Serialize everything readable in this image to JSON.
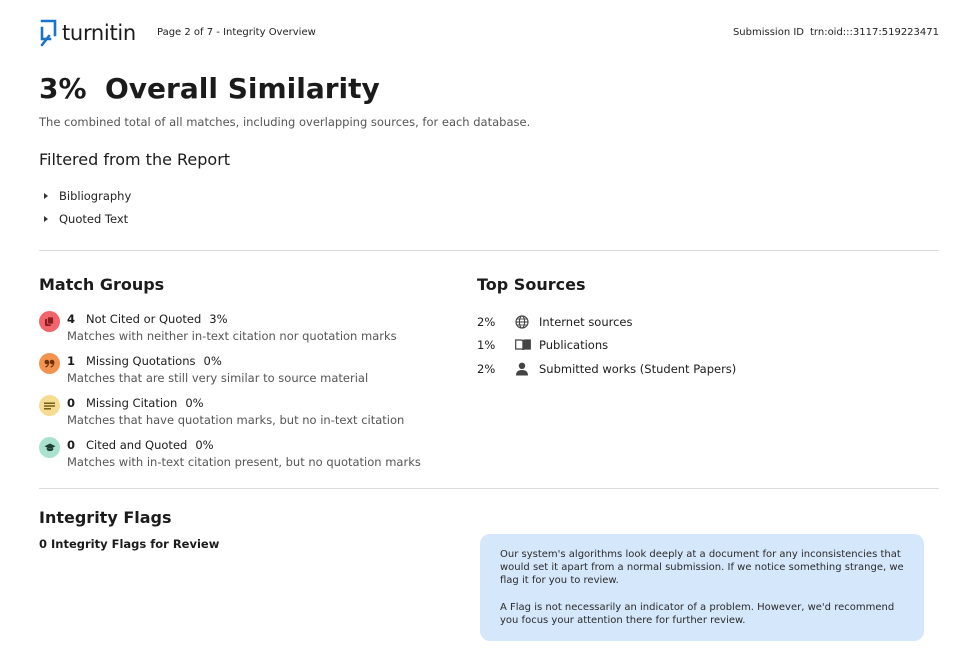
{
  "header": {
    "logo_text": "turnitin",
    "page_info": "Page 2 of 7 - Integrity Overview",
    "submission_label": "Submission ID",
    "submission_id": "trn:oid:::3117:519223471"
  },
  "similarity": {
    "percent": "3%",
    "title": "Overall Similarity",
    "description": "The combined total of all matches, including overlapping sources, for each database."
  },
  "filtered": {
    "title": "Filtered from the Report",
    "items": [
      "Bibliography",
      "Quoted Text"
    ]
  },
  "match_groups": {
    "title": "Match Groups",
    "items": [
      {
        "count": "4",
        "label": "Not Cited or Quoted",
        "percent": "3%",
        "description": "Matches with neither in-text citation nor quotation marks",
        "icon": "copy-icon",
        "color": "#e8444a",
        "bg": "#f2646b"
      },
      {
        "count": "1",
        "label": "Missing Quotations",
        "percent": "0%",
        "description": "Matches that are still very similar to source material",
        "icon": "quote-icon",
        "color": "#ef7f3a",
        "bg": "#f3934f"
      },
      {
        "count": "0",
        "label": "Missing Citation",
        "percent": "0%",
        "description": "Matches that have quotation marks, but no in-text citation",
        "icon": "lines-icon",
        "color": "#b08a2a",
        "bg": "#f6dc92"
      },
      {
        "count": "0",
        "label": "Cited and Quoted",
        "percent": "0%",
        "description": "Matches with in-text citation present, but no quotation marks",
        "icon": "graduation-cap-icon",
        "color": "#2f5d4d",
        "bg": "#a9e3cf"
      }
    ]
  },
  "top_sources": {
    "title": "Top Sources",
    "items": [
      {
        "percent": "2%",
        "label": "Internet sources",
        "icon": "globe-icon"
      },
      {
        "percent": "1%",
        "label": "Publications",
        "icon": "book-icon"
      },
      {
        "percent": "2%",
        "label": "Submitted works (Student Papers)",
        "icon": "person-icon"
      }
    ]
  },
  "integrity_flags": {
    "title": "Integrity Flags",
    "subtitle": "0 Integrity Flags for Review",
    "info_p1": "Our system's algorithms look deeply at a document for any inconsistencies that would set it apart from a normal submission. If we notice something strange, we flag it for you to review.",
    "info_p2": "A Flag is not necessarily an indicator of a problem. However, we'd recommend you focus your attention there for further review."
  },
  "colors": {
    "brand_blue": "#1a72c9",
    "info_box_bg": "#d5e7fb"
  }
}
